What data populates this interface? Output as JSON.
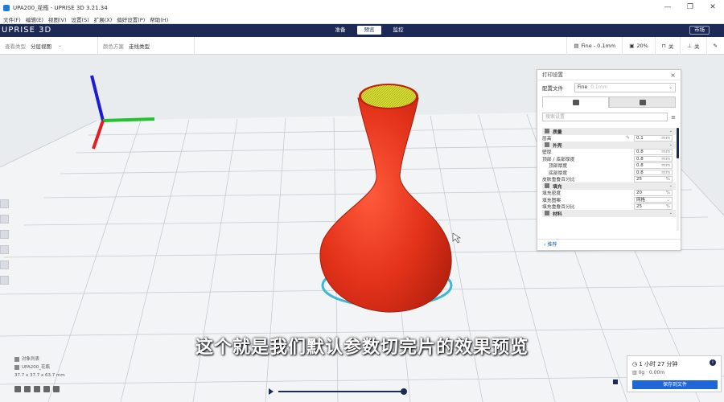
{
  "window": {
    "title": "UPA200_花瓶 - UPRISE 3D 3.21.34",
    "controls": [
      "—",
      "❐",
      "✕"
    ]
  },
  "menu": [
    "文件(F)",
    "编辑(E)",
    "视图(V)",
    "设置(S)",
    "扩展(X)",
    "偏好设置(P)",
    "帮助(H)"
  ],
  "header": {
    "brand": "UPRISE 3D",
    "stages": [
      "准备",
      "预览",
      "监控"
    ],
    "active_stage": 1,
    "market": "市场"
  },
  "toolbar": {
    "view_type_label": "查看类型",
    "view_type_value": "分层视图",
    "color_scheme_label": "颜色方案",
    "color_scheme_value": "走线类型",
    "profile": "Fine - 0.1mm",
    "infill": "20%",
    "support": "关",
    "adhesion": "关"
  },
  "panel": {
    "title": "打印设置",
    "profile_label": "配置文件",
    "profile_value": "Fine",
    "profile_hint": "0.1mm",
    "search_placeholder": "搜索设置",
    "rows": [
      {
        "type": "cat",
        "name": "质量"
      },
      {
        "type": "row",
        "name": "层高",
        "value": "0.1",
        "unit": "mm",
        "edited": true
      },
      {
        "type": "cat",
        "name": "外壳"
      },
      {
        "type": "row",
        "name": "壁厚",
        "value": "0.8",
        "unit": "mm"
      },
      {
        "type": "row",
        "name": "顶部 / 底部厚度",
        "value": "0.8",
        "unit": "mm"
      },
      {
        "type": "row",
        "name": "顶部厚度",
        "value": "0.8",
        "unit": "mm",
        "indent": true
      },
      {
        "type": "row",
        "name": "底部厚度",
        "value": "0.8",
        "unit": "mm",
        "indent": true
      },
      {
        "type": "row",
        "name": "皮肤重叠百分比",
        "value": "25",
        "unit": "%"
      },
      {
        "type": "cat",
        "name": "填充"
      },
      {
        "type": "row",
        "name": "填充密度",
        "value": "20",
        "unit": "%"
      },
      {
        "type": "row",
        "name": "填充图案",
        "value": "网格",
        "unit": "⌄"
      },
      {
        "type": "row",
        "name": "填充重叠百分比",
        "value": "25",
        "unit": "%"
      },
      {
        "type": "cat",
        "name": "材料"
      }
    ],
    "back": "推荐"
  },
  "subtitle": "这个就是我们默认参数切完片的效果预览",
  "object_list": {
    "title": "对象列表",
    "item": "UPA200_花瓶",
    "dims": "37.7 x 37.7 x 63.7 mm"
  },
  "estimate": {
    "time": "1 小时 27 分钟",
    "material": "0g · 0.00m",
    "save": "保存到文件"
  },
  "colors": {
    "header": "#1d2a56",
    "vase": "#e8321a",
    "vase_top": "#c9d42a",
    "skirt": "#3fb7d6",
    "save": "#1f66d6"
  }
}
